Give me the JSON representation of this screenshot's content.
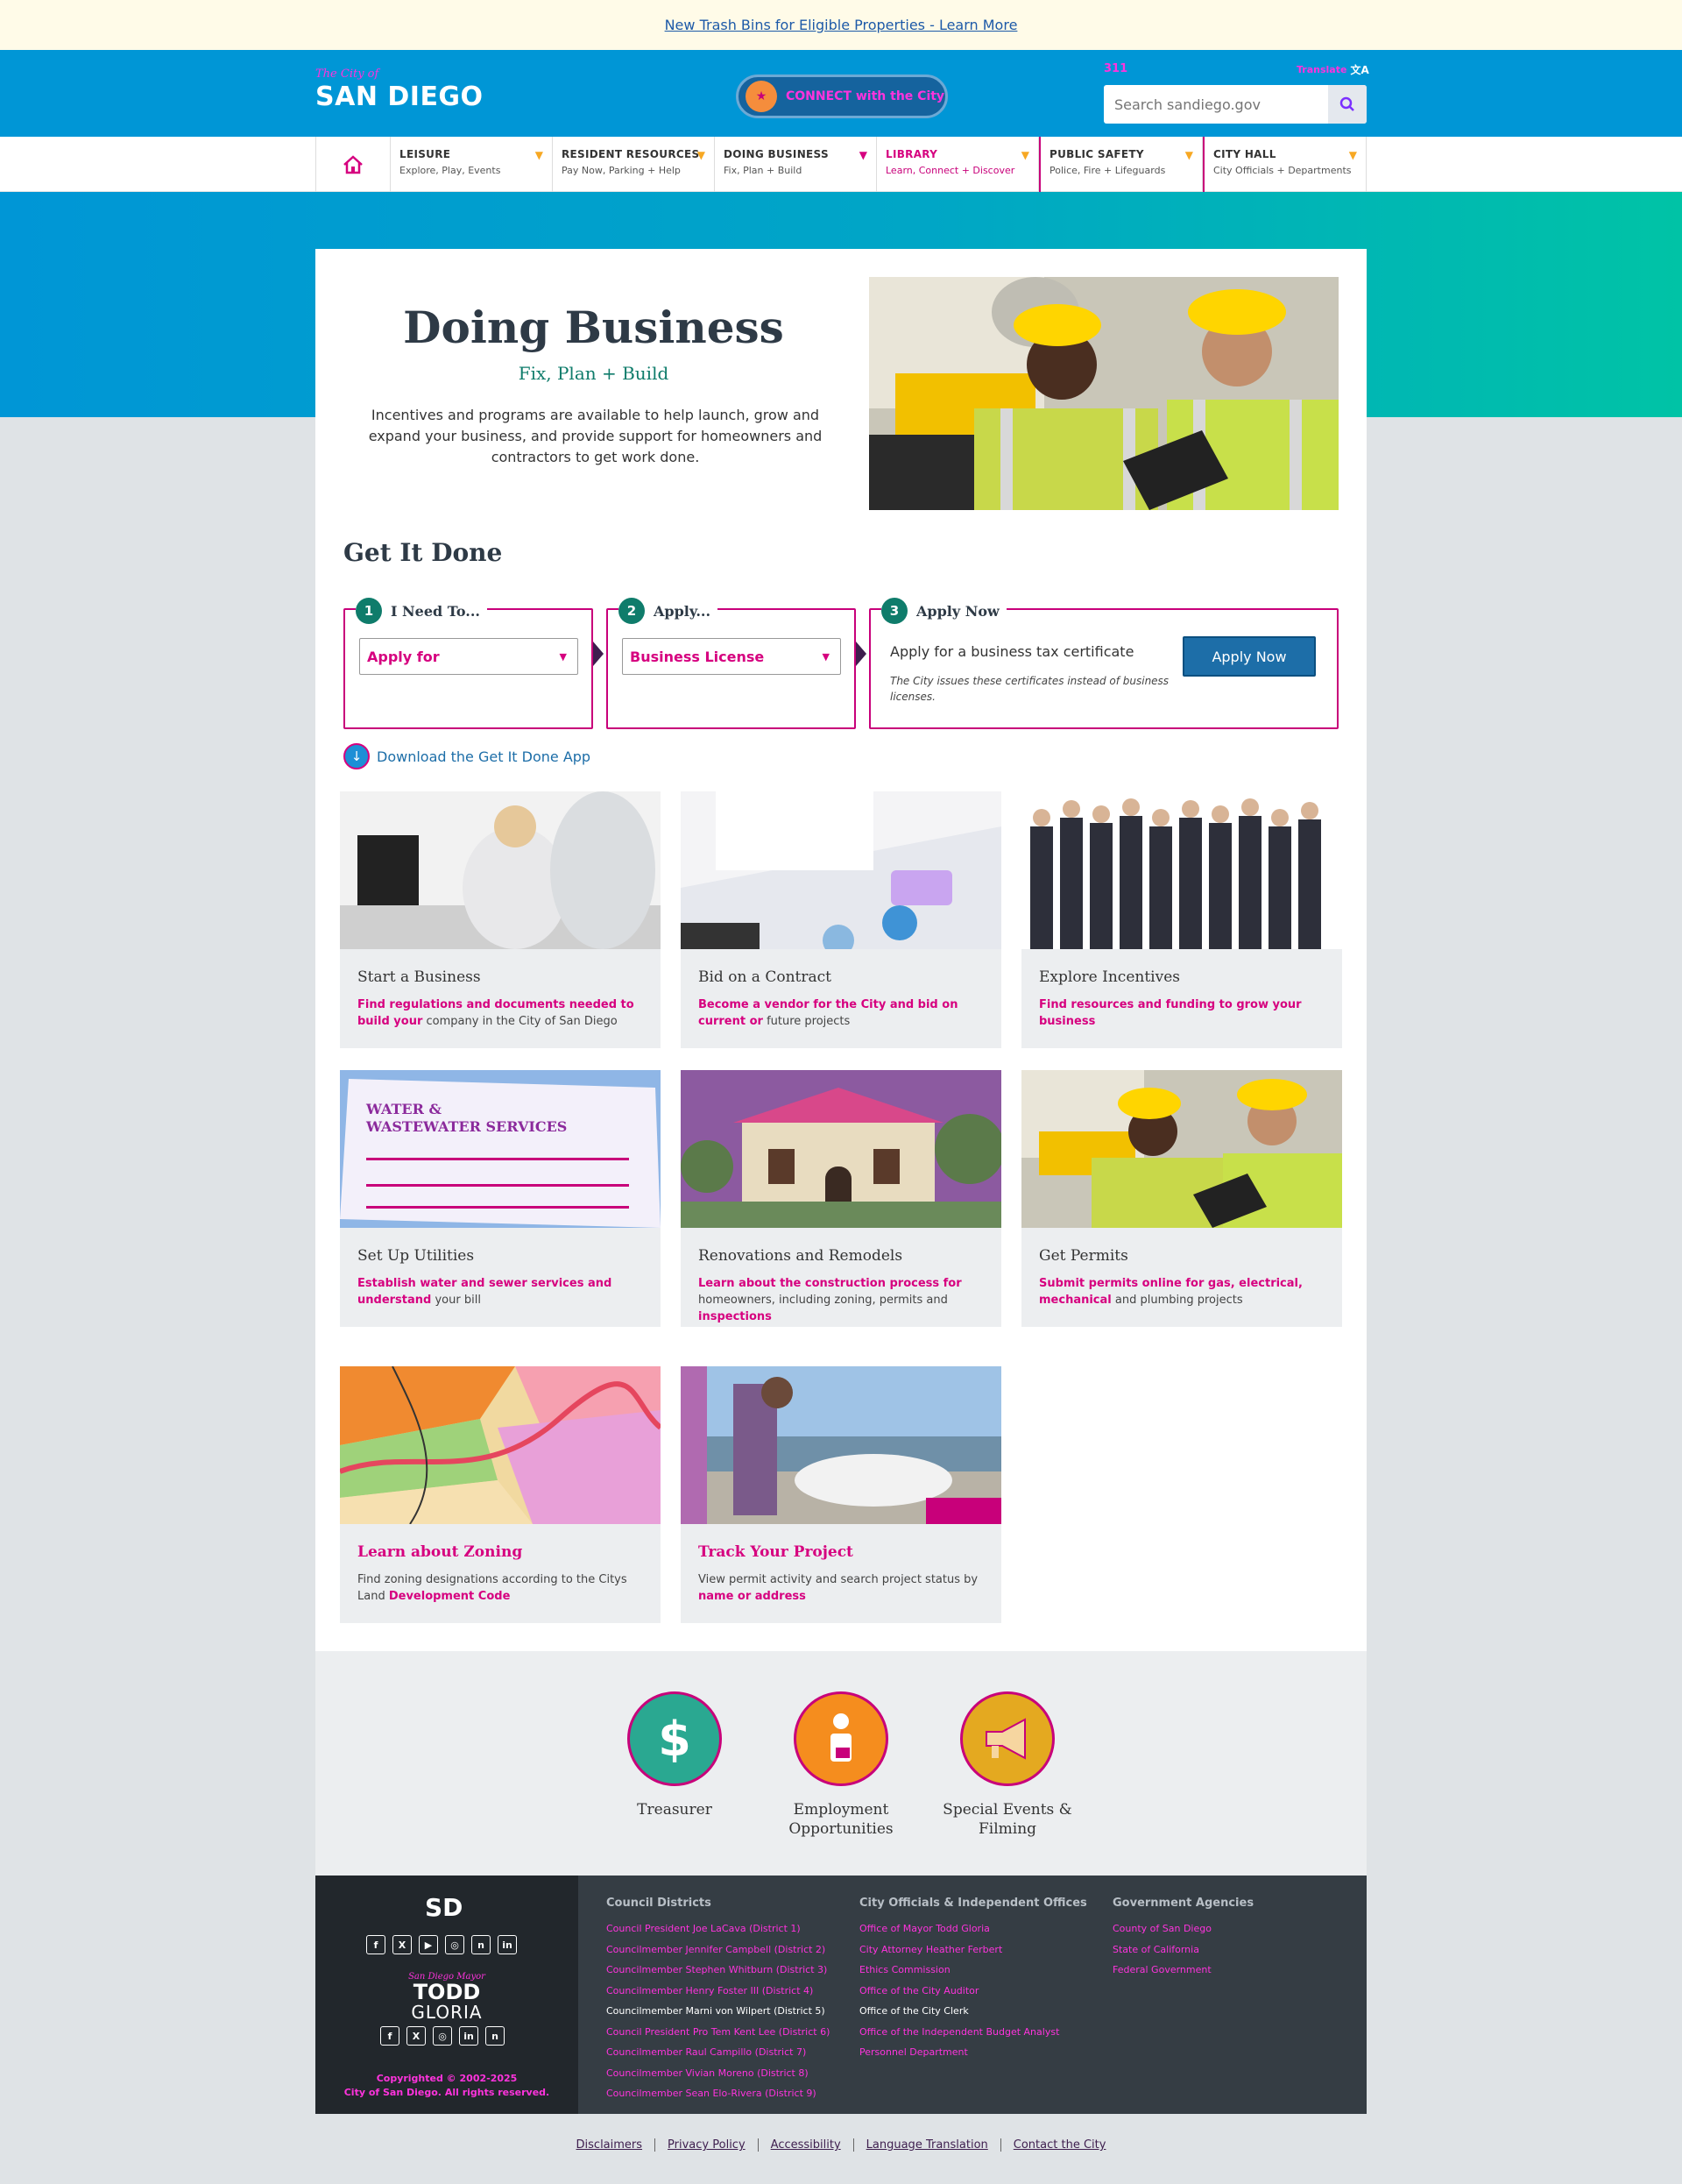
{
  "alert": {
    "link_text": "New Trash Bins for Eligible Properties - Learn More"
  },
  "header": {
    "logo_small": "The City of",
    "logo_big": "SAN DIEGO",
    "connect_icon": "CONNECT",
    "connect_text": "CONNECT with the City",
    "top_left_label": "311",
    "translate_label": "Translate",
    "translate_icon": "文A",
    "search_placeholder": "Search sandiego.gov",
    "search_icon": "search-icon"
  },
  "nav": {
    "home_icon": "home-icon",
    "items": [
      {
        "title": "LEISURE",
        "sub": "Explore, Play, Events"
      },
      {
        "title": "RESIDENT RESOURCES",
        "sub": "Pay Now, Parking + Help"
      },
      {
        "title": "DOING BUSINESS",
        "sub": "Fix, Plan + Build"
      },
      {
        "title": "LIBRARY",
        "sub": "Learn, Connect + Discover"
      },
      {
        "title": "PUBLIC SAFETY",
        "sub": "Police, Fire + Lifeguards"
      },
      {
        "title": "CITY HALL",
        "sub": "City Officials + Departments"
      }
    ]
  },
  "hero": {
    "title": "Doing Business",
    "subtitle": "Fix, Plan + Build",
    "description": "Incentives and programs are available to help launch, grow and expand your business, and provide support for homeowners and contractors to get work done."
  },
  "get_it_done": {
    "title": "Get It Done",
    "step1": {
      "num": "1",
      "label": "I Need To...",
      "value": "Apply for"
    },
    "step2": {
      "num": "2",
      "label": "Apply...",
      "value": "Business License"
    },
    "step3": {
      "num": "3",
      "label": "Apply Now",
      "text": "Apply for a business tax certificate",
      "note": "The City issues these certificates instead of business licenses.",
      "button": "Apply Now"
    },
    "download": "Download the Get It Done App"
  },
  "cards": [
    {
      "title": "Start a Business",
      "desc_a": "Find regulations and documents needed to build your",
      "desc_b": " company in the City of San Diego"
    },
    {
      "title": "Bid on a Contract",
      "desc_a": "Become a vendor for the City and bid on current or",
      "desc_b": " future projects"
    },
    {
      "title": "Explore Incentives",
      "desc_a": "Find resources and funding to grow your business",
      "desc_b": ""
    },
    {
      "title": "Set Up Utilities",
      "desc_a": "Establish water and sewer services and understand",
      "desc_b": " your bill"
    },
    {
      "title": "Renovations and Remodels",
      "desc_a": "Learn about the construction process for",
      "desc_b": " homeowners, including zoning, permits and ",
      "desc_c": "inspections"
    },
    {
      "title": "Get Permits",
      "desc_a": "Submit permits online for gas, electrical, mechanical",
      "desc_b": " and plumbing projects"
    },
    {
      "title": "Learn about Zoning",
      "desc_b": "Find zoning designations according to the Citys Land ",
      "desc_c": "Development Code"
    },
    {
      "title": "Track Your Project",
      "desc_b": "View permit activity and search project status by ",
      "desc_c": "name or address"
    }
  ],
  "features": [
    {
      "label": "Treasurer",
      "icon": "dollar-icon",
      "glyph": "$",
      "color": "#2aa891"
    },
    {
      "label": "Employment Opportunities",
      "icon": "employee-icon",
      "glyph": "♙",
      "color": "#f58d1e"
    },
    {
      "label": "Special Events & Filming",
      "icon": "megaphone-icon",
      "glyph": "📣",
      "color": "#e4a920"
    }
  ],
  "footer": {
    "sd_logo": "SD",
    "social1": [
      "f",
      "X",
      "▶",
      "◎",
      "n",
      "in"
    ],
    "social2": [
      "f",
      "X",
      "◎",
      "in",
      "n"
    ],
    "mayor_label": "San Diego Mayor",
    "mayor_first": "TODD",
    "mayor_last": "GLORIA",
    "copyright_1": "Copyrighted © 2002-2025",
    "copyright_2": "City of San Diego. All rights reserved.",
    "col1": {
      "heading": "Council Districts",
      "links": [
        "Council President Joe LaCava (District 1)",
        "Councilmember Jennifer Campbell (District 2)",
        "Councilmember Stephen Whitburn (District 3)",
        "Councilmember Henry Foster III (District 4)",
        "Councilmember Marni von Wilpert (District 5)",
        "Council President Pro Tem Kent Lee (District 6)",
        "Councilmember Raul Campillo (District 7)",
        "Councilmember Vivian Moreno (District 8)",
        "Councilmember Sean Elo-Rivera (District 9)"
      ]
    },
    "col2": {
      "heading": "City Officials & Independent Offices",
      "links": [
        "Office of Mayor Todd Gloria",
        "City Attorney Heather Ferbert",
        "Ethics Commission",
        "Office of the City Auditor",
        "Office of the City Clerk",
        "Office of the Independent Budget Analyst",
        "Personnel Department"
      ]
    },
    "col3": {
      "heading": "Government Agencies",
      "links": [
        "County of San Diego",
        "State of California",
        "Federal Government"
      ]
    }
  },
  "legal": [
    "Disclaimers",
    "Privacy Policy",
    "Accessibility",
    "Language Translation",
    "Contact the City"
  ]
}
